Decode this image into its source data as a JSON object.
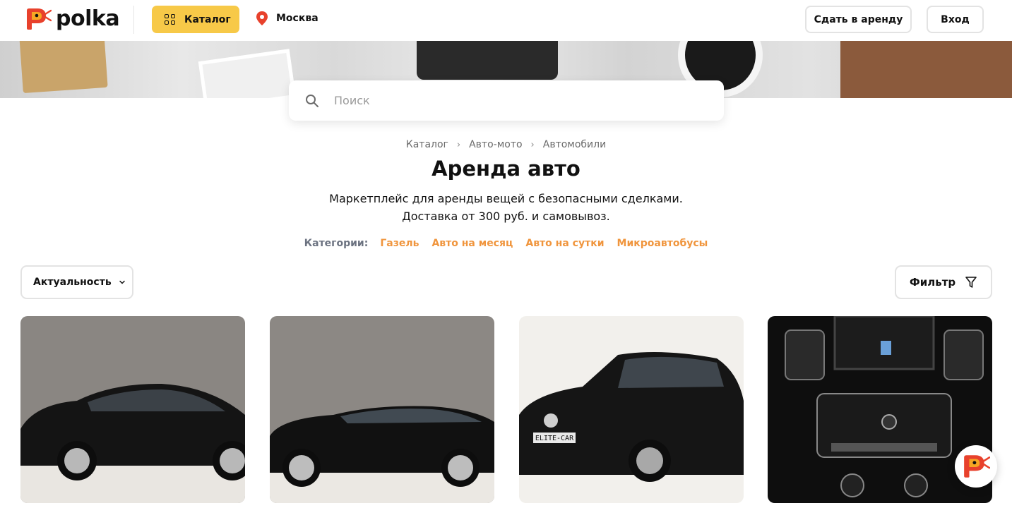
{
  "header": {
    "logo_text": "polka",
    "catalog_label": "Каталог",
    "city": "Москва",
    "rent_out_label": "Сдать в аренду",
    "login_label": "Вход"
  },
  "search": {
    "placeholder": "Поиск"
  },
  "breadcrumb": [
    "Каталог",
    "Авто-мото",
    "Автомобили"
  ],
  "page_title": "Аренда авто",
  "subtitle_line1": "Маркетплейс для аренды вещей с безопасными сделками.",
  "subtitle_line2": "Доставка от 300 руб. и самовывоз.",
  "categories": {
    "label": "Категории:",
    "items": [
      "Газель",
      "Авто на месяц",
      "Авто на сутки",
      "Микроавтобусы"
    ]
  },
  "sort": {
    "selected": "Актуальность"
  },
  "filter_label": "Фильтр",
  "listing_images": [
    "black-sedan-photo",
    "black-sportback-photo",
    "black-suv-photo",
    "car-interior-photo"
  ],
  "plate_text": "ELITE-CAR",
  "colors": {
    "accent_yellow": "#f7c948",
    "category_orange": "#f0953d",
    "logo_red": "#e8412c"
  }
}
